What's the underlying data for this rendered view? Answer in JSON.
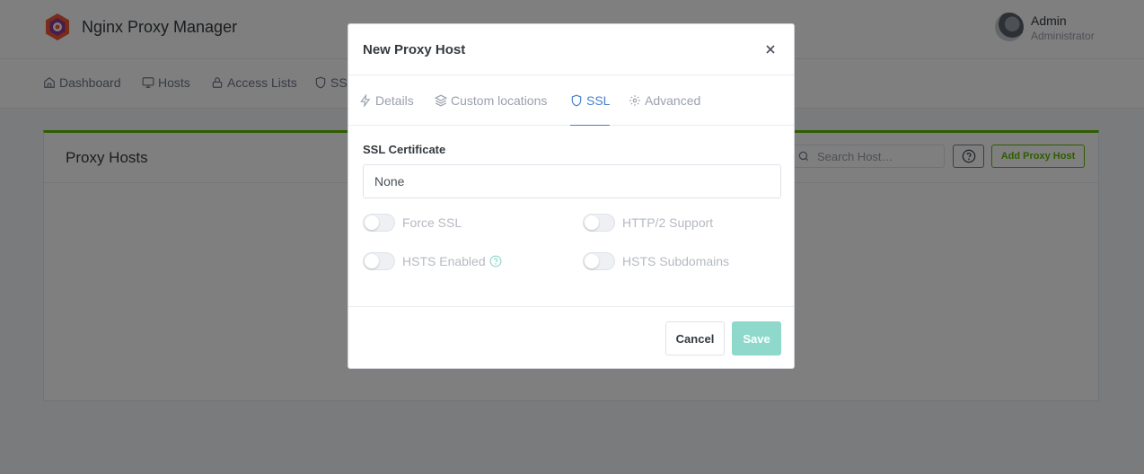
{
  "app": {
    "title": "Nginx Proxy Manager",
    "logo_icon": "nginx-proxy-manager-logo"
  },
  "user": {
    "name": "Admin",
    "role": "Administrator"
  },
  "nav": {
    "items": [
      {
        "label": "Dashboard",
        "icon": "home-icon"
      },
      {
        "label": "Hosts",
        "icon": "monitor-icon"
      },
      {
        "label": "Access Lists",
        "icon": "lock-icon"
      },
      {
        "label": "SSL",
        "icon": "shield-icon"
      }
    ]
  },
  "card": {
    "title": "Proxy Hosts",
    "search_placeholder": "Search Host…",
    "add_label": "Add Proxy Host",
    "accent_color": "#5eba00"
  },
  "modal": {
    "title": "New Proxy Host",
    "tabs": [
      {
        "label": "Details",
        "icon": "bolt-icon"
      },
      {
        "label": "Custom locations",
        "icon": "layers-icon"
      },
      {
        "label": "SSL",
        "icon": "shield-icon",
        "active": true
      },
      {
        "label": "Advanced",
        "icon": "gear-icon"
      }
    ],
    "ssl": {
      "certificate_label": "SSL Certificate",
      "certificate_value": "None",
      "toggles": [
        {
          "label": "Force SSL",
          "on": false
        },
        {
          "label": "HTTP/2 Support",
          "on": false
        },
        {
          "label": "HSTS Enabled",
          "on": false
        },
        {
          "label": "HSTS Subdomains",
          "on": false
        }
      ]
    },
    "cancel_label": "Cancel",
    "save_label": "Save",
    "active_tab_color": "#467fcf",
    "save_color": "#8fd9cc"
  }
}
